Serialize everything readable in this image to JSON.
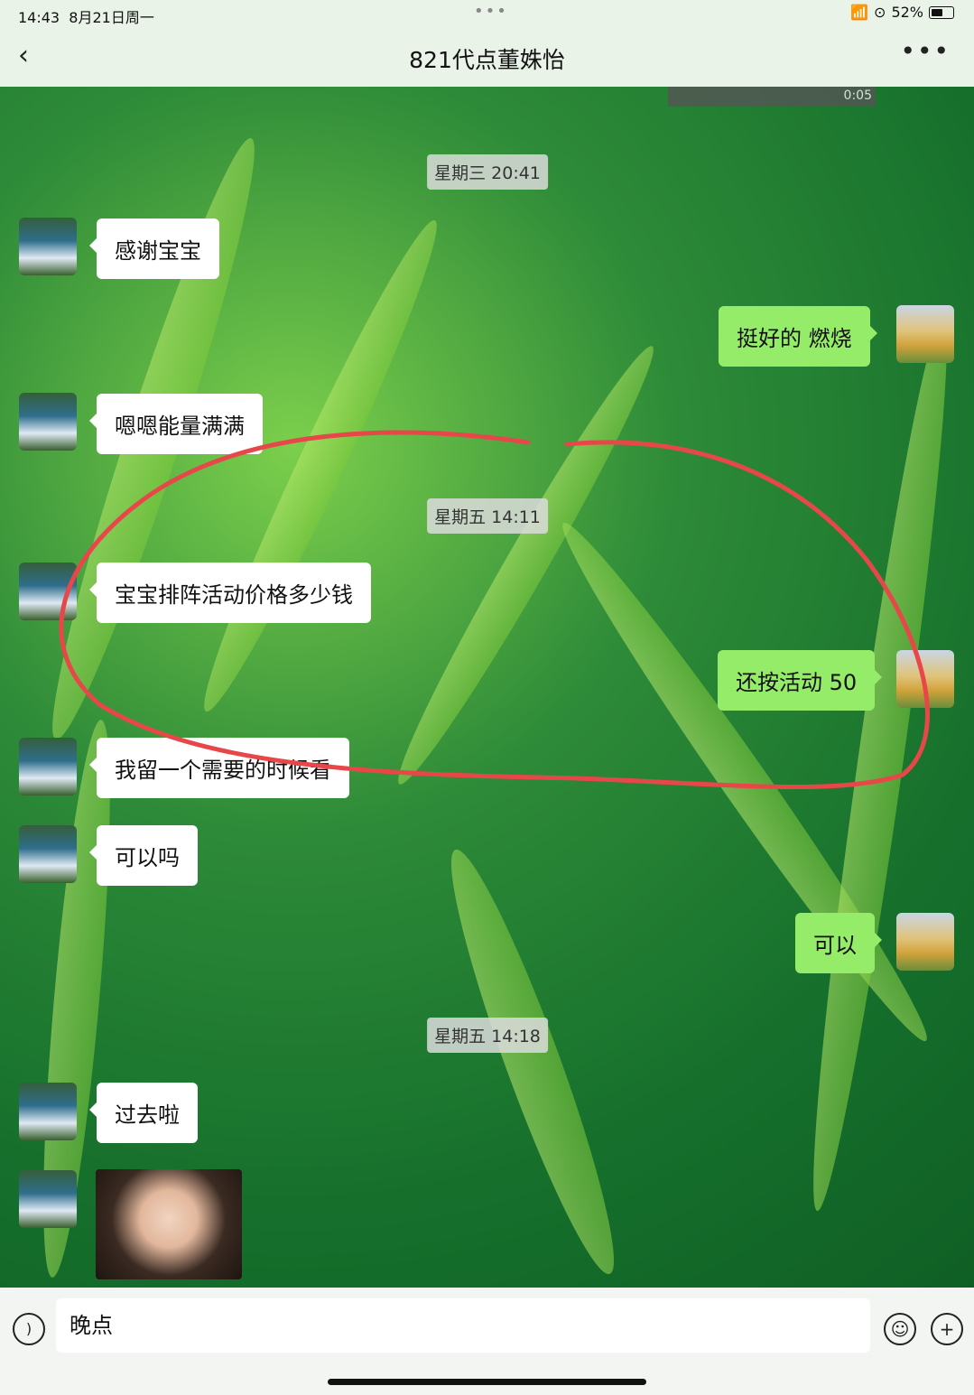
{
  "status": {
    "time": "14:43",
    "date": "8月21日周一",
    "battery": "52%",
    "battery_level": 0.52,
    "dots": "•••"
  },
  "nav": {
    "back_icon": "chevron-left-icon",
    "title": "821代点董姝怡",
    "more_icon": "more-dots-icon"
  },
  "video": {
    "duration": "0:05"
  },
  "timestamps": [
    "星期三 20:41",
    "星期五 14:11",
    "星期五 14:18"
  ],
  "messages": [
    {
      "side": "left",
      "text": "感谢宝宝"
    },
    {
      "side": "right",
      "text": "挺好的 燃烧"
    },
    {
      "side": "left",
      "text": "嗯嗯能量满满"
    },
    {
      "side": "left",
      "text": "宝宝排阵活动价格多少钱"
    },
    {
      "side": "right",
      "text": "还按活动 50"
    },
    {
      "side": "left",
      "text": "我留一个需要的时候看"
    },
    {
      "side": "left",
      "text": "可以吗"
    },
    {
      "side": "right",
      "text": "可以"
    },
    {
      "side": "left",
      "text": "过去啦"
    },
    {
      "side": "left",
      "type": "image"
    }
  ],
  "input": {
    "value": "晚点",
    "voice_icon": "voice-icon",
    "emoji_icon": "emoji-icon",
    "plus_icon": "plus-icon"
  },
  "colors": {
    "annotation": "#e8474a",
    "self_bubble": "#95ec69"
  }
}
